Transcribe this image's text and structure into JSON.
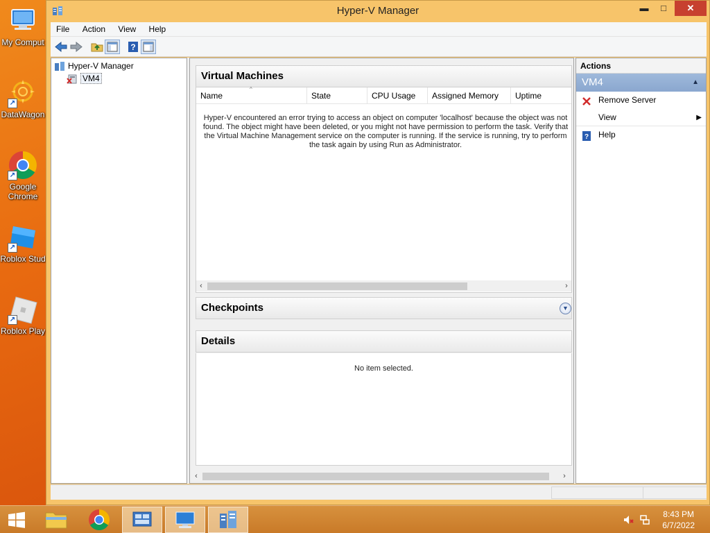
{
  "desktop": {
    "icons": [
      {
        "label": "My Comput",
        "icon": "computer-icon"
      },
      {
        "label": "DataWagon",
        "icon": "datawagon-icon"
      },
      {
        "label": "Google Chrome",
        "icon": "chrome-icon"
      },
      {
        "label": "Roblox Stud",
        "icon": "roblox-studio-icon"
      },
      {
        "label": "Roblox Play",
        "icon": "roblox-player-icon"
      }
    ]
  },
  "window": {
    "title": "Hyper-V Manager",
    "controls": {
      "minimize": "▬",
      "maximize": "□",
      "close": "✕"
    },
    "menu": [
      "File",
      "Action",
      "View",
      "Help"
    ],
    "toolbar": [
      "back-icon",
      "forward-icon",
      "up-folder-icon",
      "show-hide-tree-icon",
      "help-icon",
      "show-hide-action-pane-icon"
    ]
  },
  "tree": {
    "root": "Hyper-V Manager",
    "server": "VM4"
  },
  "vm_panel": {
    "title": "Virtual Machines",
    "columns": [
      "Name",
      "State",
      "CPU Usage",
      "Assigned Memory",
      "Uptime"
    ],
    "error": "Hyper-V encountered an error trying to access an object on computer 'localhost' because the object was not found. The object might have been deleted, or you might not have permission to perform the task. Verify that the Virtual Machine Management service on the computer is running. If the service is running, try to perform the task again by using Run as Administrator."
  },
  "checkpoints_panel": {
    "title": "Checkpoints"
  },
  "details_panel": {
    "title": "Details",
    "empty": "No item selected."
  },
  "actions": {
    "title": "Actions",
    "group": "VM4",
    "items": [
      {
        "label": "Remove Server",
        "icon": "remove-icon"
      },
      {
        "label": "View",
        "icon": "",
        "submenu": true
      },
      {
        "label": "Help",
        "icon": "help-icon"
      }
    ]
  },
  "taskbar": {
    "time": "8:43 PM",
    "date": "6/7/2022",
    "apps": [
      "start-button",
      "file-explorer-icon",
      "chrome-icon",
      "server-manager-icon",
      "remote-desktop-icon",
      "hyper-v-manager-icon"
    ]
  },
  "colors": {
    "desktop": "#e86a10",
    "window_frame": "#f7c46a",
    "actions_group": "#8aa7cf",
    "close_button": "#c7402f"
  }
}
